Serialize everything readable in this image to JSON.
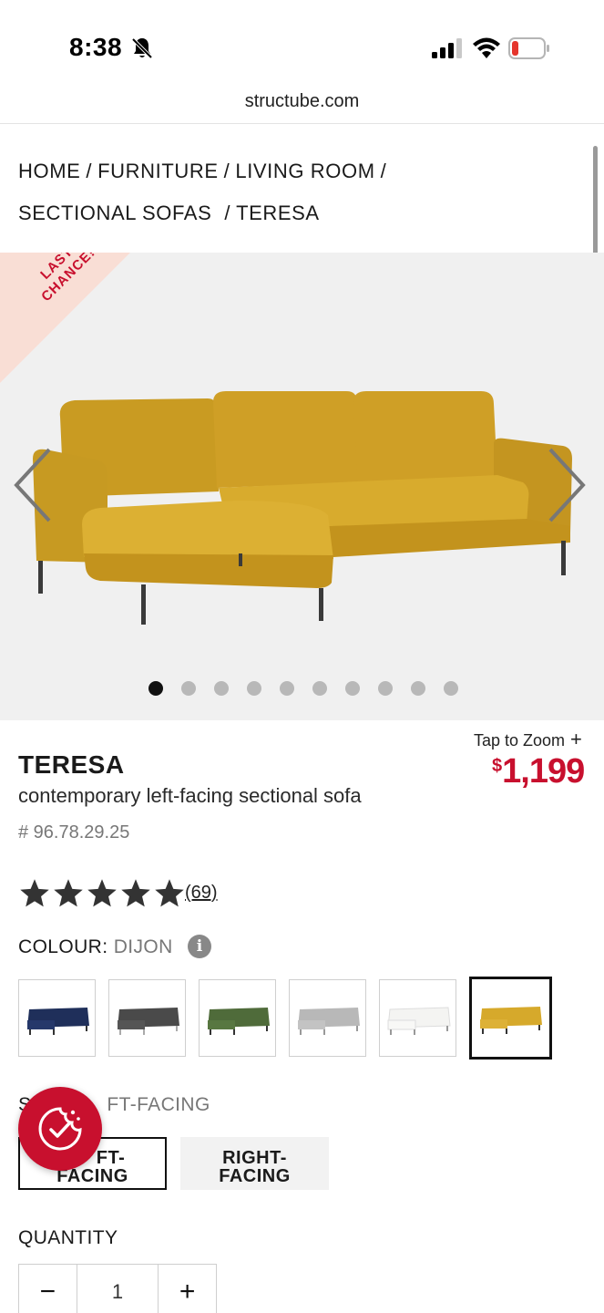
{
  "status_bar": {
    "time": "8:38",
    "icons": [
      "bell-slash-icon",
      "signal-icon",
      "wifi-icon",
      "battery-low-icon"
    ]
  },
  "browser": {
    "url": "structube.com"
  },
  "breadcrumb": {
    "items": [
      "HOME",
      "FURNITURE",
      "LIVING ROOM",
      "SECTIONAL SOFAS",
      "TERESA"
    ],
    "separator": "/"
  },
  "gallery": {
    "ribbon": "LAST CHANCE!",
    "ribbon_line1": "LAST",
    "ribbon_line2": "CHANCE!",
    "image_count": 10,
    "active_index": 0,
    "sofa_color": "#d6a92b"
  },
  "product": {
    "tap_to_zoom": "Tap to Zoom",
    "name": "TERESA",
    "description": "contemporary left-facing sectional sofa",
    "sku": "# 96.78.29.25",
    "price_currency": "$",
    "price_value": "1,199",
    "rating": 5,
    "review_count": "(69)"
  },
  "colour": {
    "label": "COLOUR:",
    "selected": "DIJON",
    "swatches": [
      {
        "name": "navy",
        "color": "#1f2f5a"
      },
      {
        "name": "charcoal",
        "color": "#4a4a4a"
      },
      {
        "name": "green",
        "color": "#4f6b3a"
      },
      {
        "name": "light-grey",
        "color": "#b8b8b8"
      },
      {
        "name": "white",
        "color": "#f4f4f2"
      },
      {
        "name": "dijon",
        "color": "#d6a92b"
      }
    ]
  },
  "side": {
    "label_prefix": "S",
    "label_value": "FT-FACING",
    "options": [
      {
        "line1": "FT-",
        "line2": "FACING"
      },
      {
        "line1": "RIGHT-",
        "line2": "FACING"
      }
    ]
  },
  "quantity": {
    "label": "QUANTITY",
    "minus": "−",
    "value": "1",
    "plus": "+"
  },
  "colors": {
    "accent_red": "#c8102e",
    "ribbon_bg": "#f9ded5",
    "gallery_bg": "#f0f0f0"
  }
}
